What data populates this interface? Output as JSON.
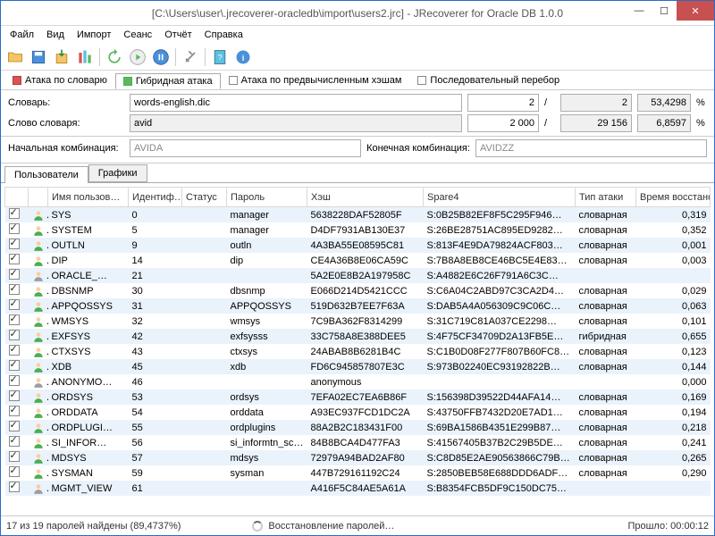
{
  "window": {
    "title": "[C:\\Users\\user\\.jrecoverer-oracledb\\import\\users2.jrc] - JRecoverer for Oracle DB 1.0.0"
  },
  "menu": [
    "Файл",
    "Вид",
    "Импорт",
    "Сеанс",
    "Отчёт",
    "Справка"
  ],
  "attack_tabs": [
    {
      "label": "Атака по словарю",
      "enabled": true,
      "active": false,
      "color": "red"
    },
    {
      "label": "Гибридная атака",
      "enabled": true,
      "active": true,
      "color": "green"
    },
    {
      "label": "Атака по предвычисленным хэшам",
      "enabled": false,
      "active": false,
      "color": "off"
    },
    {
      "label": "Последовательный перебор",
      "enabled": false,
      "active": false,
      "color": "off"
    }
  ],
  "params": {
    "dict_label": "Словарь:",
    "dict_value": "words-english.dic",
    "dict_cur": "2",
    "dict_total": "2",
    "dict_pct": "53,4298",
    "word_label": "Слово словаря:",
    "word_value": "avid",
    "word_cur": "2 000",
    "word_total": "29 156",
    "word_pct": "6,8597",
    "start_label": "Начальная комбинация:",
    "start_value": "AVIDA",
    "end_label": "Конечная комбинация:",
    "end_value": "AVIDZZ",
    "pct": "%",
    "slash": "/"
  },
  "sub_tabs": [
    "Пользователи",
    "Графики"
  ],
  "cols": {
    "user": "Имя пользов…",
    "id": "Идентиф…",
    "status": "Статус",
    "pass": "Пароль",
    "hash": "Хэш",
    "spare4": "Spare4",
    "attack": "Тип атаки",
    "time": "Время восстанов…"
  },
  "rows": [
    {
      "c": true,
      "g": true,
      "u": "SYS",
      "id": "0",
      "p": "manager",
      "h": "5638228DAF52805F",
      "s": "S:0B25B82EF8F5C295F946…",
      "a": "словарная",
      "t": "0,319"
    },
    {
      "c": true,
      "g": true,
      "u": "SYSTEM",
      "id": "5",
      "p": "manager",
      "h": "D4DF7931AB130E37",
      "s": "S:26BE28751AC895ED9282…",
      "a": "словарная",
      "t": "0,352"
    },
    {
      "c": true,
      "g": true,
      "u": "OUTLN",
      "id": "9",
      "p": "outln",
      "h": "4A3BA55E08595C81",
      "s": "S:813F4E9DA79824ACF803…",
      "a": "словарная",
      "t": "0,001"
    },
    {
      "c": true,
      "g": true,
      "u": "DIP",
      "id": "14",
      "p": "dip",
      "h": "CE4A36B8E06CA59C",
      "s": "S:7B8A8EB8CE46BC5E4E83…",
      "a": "словарная",
      "t": "0,003"
    },
    {
      "c": true,
      "g": false,
      "u": "ORACLE_…",
      "id": "21",
      "p": "",
      "h": "5A2E0E8B2A197958C",
      "s": "S:A4882E6C26F791A6C3C…",
      "a": "",
      "t": ""
    },
    {
      "c": true,
      "g": true,
      "u": "DBSNMP",
      "id": "30",
      "p": "dbsnmp",
      "h": "E066D214D5421CCC",
      "s": "S:C6A04C2ABD97C3CA2D4…",
      "a": "словарная",
      "t": "0,029"
    },
    {
      "c": true,
      "g": true,
      "u": "APPQOSSYS",
      "id": "31",
      "p": "APPQOSSYS",
      "h": "519D632B7EE7F63A",
      "s": "S:DAB5A4A056309C9C06C…",
      "a": "словарная",
      "t": "0,063"
    },
    {
      "c": true,
      "g": true,
      "u": "WMSYS",
      "id": "32",
      "p": "wmsys",
      "h": "7C9BA362F8314299",
      "s": "S:31C719C81A037CE2298…",
      "a": "словарная",
      "t": "0,101"
    },
    {
      "c": true,
      "g": true,
      "u": "EXFSYS",
      "id": "42",
      "p": "exfsysss",
      "h": "33C758A8E388DEE5",
      "s": "S:4F75CF34709D2A13FB5E…",
      "a": "гибридная",
      "t": "0,655"
    },
    {
      "c": true,
      "g": true,
      "u": "CTXSYS",
      "id": "43",
      "p": "ctxsys",
      "h": "24ABAB8B6281B4C",
      "s": "S:C1B0D08F277F807B60FC8…",
      "a": "словарная",
      "t": "0,123"
    },
    {
      "c": true,
      "g": true,
      "u": "XDB",
      "id": "45",
      "p": "xdb",
      "h": "FD6C945857807E3C",
      "s": "S:973B02240EC93192822B…",
      "a": "словарная",
      "t": "0,144"
    },
    {
      "c": true,
      "g": false,
      "u": "ANONYMO…",
      "id": "46",
      "p": "",
      "h": "anonymous",
      "s": "",
      "a": "",
      "t": "0,000"
    },
    {
      "c": true,
      "g": true,
      "u": "ORDSYS",
      "id": "53",
      "p": "ordsys",
      "h": "7EFA02EC7EA6B86F",
      "s": "S:156398D39522D44AFA14…",
      "a": "словарная",
      "t": "0,169"
    },
    {
      "c": true,
      "g": true,
      "u": "ORDDATA",
      "id": "54",
      "p": "orddata",
      "h": "A93EC937FCD1DC2A",
      "s": "S:43750FFB7432D20E7AD1…",
      "a": "словарная",
      "t": "0,194"
    },
    {
      "c": true,
      "g": true,
      "u": "ORDPLUGI…",
      "id": "55",
      "p": "ordplugins",
      "h": "88A2B2C183431F00",
      "s": "S:69BA1586B4351E299B87…",
      "a": "словарная",
      "t": "0,218"
    },
    {
      "c": true,
      "g": true,
      "u": "SI_INFOR…",
      "id": "56",
      "p": "si_informtn_sc…",
      "h": "84B8BCA4D477FA3",
      "s": "S:41567405B37B2C29B5DE…",
      "a": "словарная",
      "t": "0,241"
    },
    {
      "c": true,
      "g": true,
      "u": "MDSYS",
      "id": "57",
      "p": "mdsys",
      "h": "72979A94BAD2AF80",
      "s": "S:C8D85E2AE90563866C79B…",
      "a": "словарная",
      "t": "0,265"
    },
    {
      "c": true,
      "g": true,
      "u": "SYSMAN",
      "id": "59",
      "p": "sysman",
      "h": "447B729161192C24",
      "s": "S:2850BEB58E688DDD6ADF…",
      "a": "словарная",
      "t": "0,290"
    },
    {
      "c": true,
      "g": false,
      "u": "MGMT_VIEW",
      "id": "61",
      "p": "",
      "h": "A416F5C84AE5A61A",
      "s": "S:B8354FCB5DF9C150DC75…",
      "a": "",
      "t": ""
    }
  ],
  "status": {
    "left": "17 из 19 паролей найдены (89,4737%)",
    "mid": "Восстановление паролей…",
    "right": "Прошло: 00:00:12"
  }
}
